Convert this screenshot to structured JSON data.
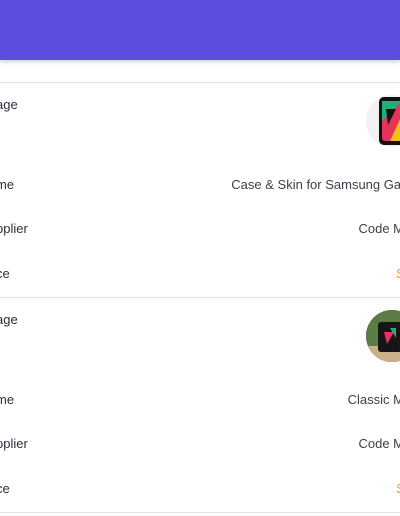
{
  "items": [
    {
      "image_label": "age",
      "image_icon": "phone-case-icon",
      "name_label": "me",
      "name_value": "Case & Skin for Samsung Gal",
      "supplier_label": "pplier",
      "supplier_value": "Code M",
      "price_label": "ce",
      "price_value": "$"
    },
    {
      "image_label": "age",
      "image_icon": "mug-icon",
      "name_label": "me",
      "name_value": "Classic M",
      "supplier_label": "pplier",
      "supplier_value": "Code M",
      "price_label": "ce",
      "price_value": "$"
    }
  ],
  "colors": {
    "header": "#5c4fe0",
    "price": "#e29a1a",
    "divider": "#e4e4e8"
  }
}
